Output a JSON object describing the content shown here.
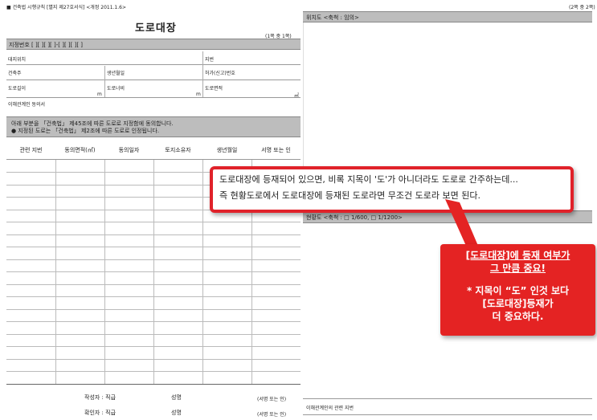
{
  "header": {
    "form_ref": "■ 건축법 시행규칙 [별지 제27호서식] <개정 2011.1.6>",
    "page_note": "(2쪽 중 2쪽)",
    "title": "도로대장",
    "page_note_left": "(1쪽 중 1쪽)"
  },
  "form": {
    "designation_no": "지정번호 [  ][  ][  ][  ]-[  ][  ][  ][  ]",
    "location_label": "대지위치",
    "lot_label": "지번",
    "owner_label": "건축주",
    "birth_label": "생년월일",
    "permit_label": "허가(신고)번호",
    "road_length_label": "도로길이",
    "road_length_unit": "m",
    "road_width_label": "도로너비",
    "road_width_unit": "m",
    "road_area_label": "도로면적",
    "road_area_unit": "㎡",
    "consent_doc_label": "이해관계인 동의서",
    "notice_line1": "아래 부분을 「건축법」 제45조에 따른 도로로 지정함에 동의합니다.",
    "notice_line2": "● 지정된 도로는 「건축법」 제2조에 따른 도로로 인정됩니다.",
    "columns": [
      "관련 지번",
      "동의면적(㎡)",
      "동의일자",
      "토지소유자",
      "생년월일",
      "서명 또는 인"
    ],
    "writer_label": "작성자 : 직급",
    "writer_name_label": "성명",
    "writer_sign": "(서명 또는 인)",
    "checker_label": "확인자 : 직급",
    "checker_name_label": "성명",
    "checker_sign": "(서명 또는 인)"
  },
  "right_panel": {
    "location_map": "위치도 <축척 : 임의>",
    "status_map": "현황도 <축척 : □ 1/600, □ 1/1200>",
    "interested_party": "이해관계인의 관련 지번"
  },
  "callout": {
    "line1": "도로대장에 등재되어 있으면, 비록 지목이 '도'가 아니더라도 도로로 간주하는데...",
    "line2": "즉 현황도로에서 도로대장에 등재된 도로라면 무조건 도로라 보면 된다."
  },
  "red_note": {
    "line1": "[도로대장]에 등재 여부가",
    "line2": "그 만큼 중요!",
    "line3": "* 지목이 “도” 인것 보다",
    "line4": "[도로대장]등재가",
    "line5": "더 중요하다."
  },
  "colors": {
    "accent_red": "#e42323",
    "bar_gray": "#bdbdbd"
  }
}
